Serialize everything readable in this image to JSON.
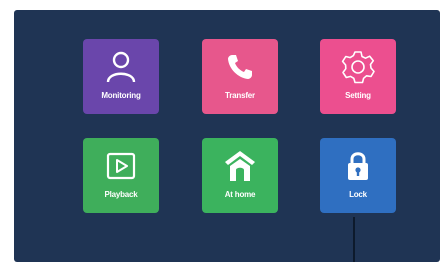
{
  "tiles": [
    {
      "label": "Monitoring",
      "icon": "person-icon",
      "color": "#6a46ab"
    },
    {
      "label": "Transfer",
      "icon": "phone-icon",
      "color": "#e7578c"
    },
    {
      "label": "Setting",
      "icon": "gear-icon",
      "color": "#ec4f8f"
    },
    {
      "label": "Playback",
      "icon": "play-icon",
      "color": "#3fae5b"
    },
    {
      "label": "At home",
      "icon": "house-icon",
      "color": "#3bb35e"
    },
    {
      "label": "Lock",
      "icon": "lock-icon",
      "color": "#2f6fc1"
    }
  ],
  "colors": {
    "background": "#1f3454"
  }
}
